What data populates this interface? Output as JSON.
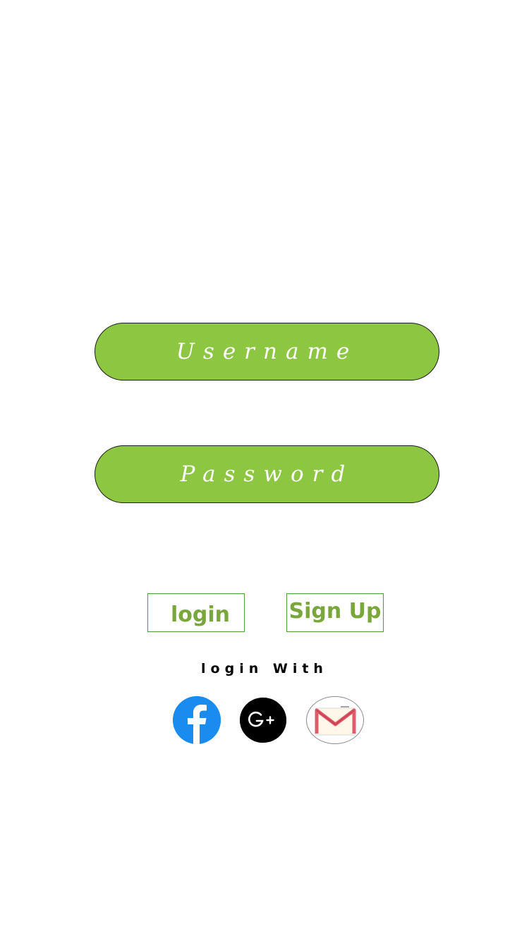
{
  "colors": {
    "accent": "#8dc641",
    "button_text": "#7aa73a",
    "button_border": "#4f9a3f",
    "facebook": "#1a8cf0",
    "google": "#000000",
    "gmail_red": "#e05a6a"
  },
  "form": {
    "username": {
      "value": "",
      "placeholder": "Username"
    },
    "password": {
      "value": "",
      "placeholder": "Password"
    }
  },
  "actions": {
    "login_label": "login",
    "signup_label": "Sign Up"
  },
  "social": {
    "heading": "login With",
    "providers": [
      {
        "name": "facebook",
        "icon": "facebook-icon"
      },
      {
        "name": "google-plus",
        "icon": "google-plus-icon"
      },
      {
        "name": "gmail",
        "icon": "gmail-icon"
      }
    ]
  }
}
